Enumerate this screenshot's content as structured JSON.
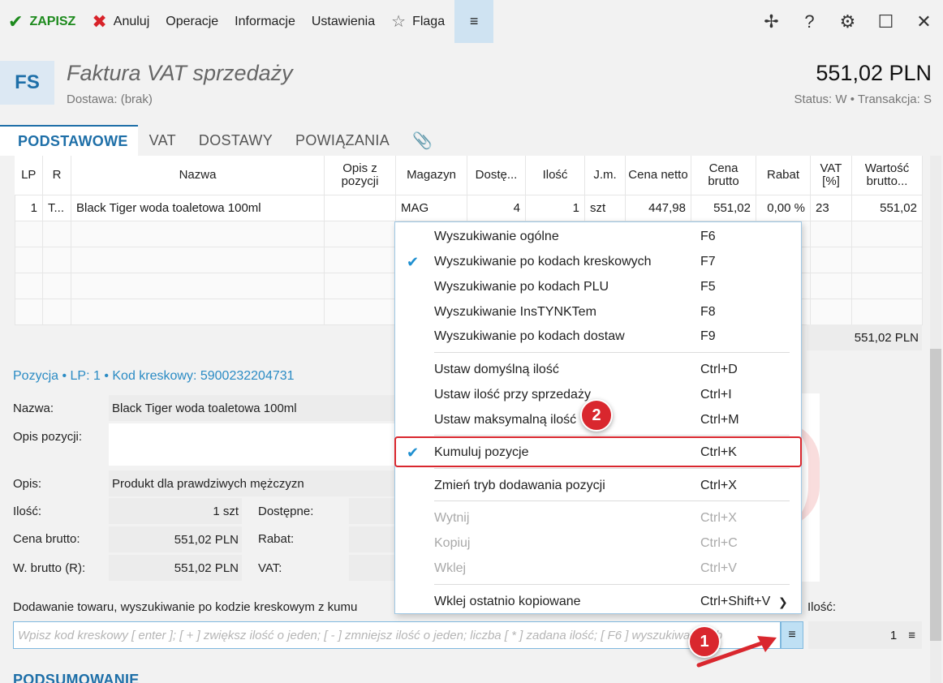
{
  "toolbar": {
    "save": "ZAPISZ",
    "cancel": "Anuluj",
    "operations": "Operacje",
    "information": "Informacje",
    "settings": "Ustawienia",
    "flag": "Flaga"
  },
  "header": {
    "badge": "FS",
    "title": "Faktura VAT sprzedaży",
    "subtitle": "Dostawa: (brak)",
    "amount": "551,02 PLN",
    "status": "Status:  W  •  Transakcja:  S"
  },
  "tabs": [
    "PODSTAWOWE",
    "VAT",
    "DOSTAWY",
    "POWIĄZANIA"
  ],
  "grid": {
    "columns": [
      "LP",
      "R",
      "Nazwa",
      "Opis z pozycji",
      "Magazyn",
      "Dostę...",
      "Ilość",
      "J.m.",
      "Cena netto",
      "Cena brutto",
      "Rabat",
      "VAT [%]",
      "Wartość brutto..."
    ],
    "row": {
      "lp": "1",
      "r": "T...",
      "name": "Black Tiger woda toaletowa 100ml",
      "desc": "",
      "warehouse": "MAG",
      "available": "4",
      "qty": "1",
      "unit": "szt",
      "net": "447,98",
      "gross": "551,02",
      "discount": "0,00 %",
      "vat": "23",
      "value": "551,02"
    },
    "total": "551,02 PLN"
  },
  "position": {
    "heading": "Pozycja •  LP: 1 •  Kod kreskowy: 5900232204731",
    "name_label": "Nazwa:",
    "name_value": "Black Tiger woda toaletowa 100ml",
    "desc_label": "Opis pozycji:",
    "opis_label": "Opis:",
    "opis_value": "Produkt dla prawdziwych mężczyzn",
    "qty_label": "Ilość:",
    "qty_value": "1 szt",
    "available_label": "Dostępne:",
    "gross_label": "Cena brutto:",
    "gross_value": "551,02 PLN",
    "discount_label": "Rabat:",
    "wgross_label": "W. brutto (R):",
    "wgross_value": "551,02 PLN",
    "vat_label": "VAT:"
  },
  "add": {
    "label": "Dodawanie towaru, wyszukiwanie po kodzie kreskowym z kumu",
    "qty_label": "Ilość:",
    "placeholder": "Wpisz kod kreskowy [ enter ]; [ + ] zwiększ ilość o jeden; [ - ] zmniejsz ilość o jeden; liczba [ * ] zadana ilość; [ F6 ] wyszukiwanie zb",
    "qty_value": "1"
  },
  "summary": "PODSUMOWANIE",
  "menu": {
    "items": [
      {
        "label": "Wyszukiwanie ogólne",
        "key": "F6"
      },
      {
        "label": "Wyszukiwanie po kodach kreskowych",
        "key": "F7"
      },
      {
        "label": "Wyszukiwanie po kodach PLU",
        "key": "F5"
      },
      {
        "label": "Wyszukiwanie InsTYNKTem",
        "key": "F8"
      },
      {
        "label": "Wyszukiwanie po kodach dostaw",
        "key": "F9"
      },
      {
        "label": "Ustaw domyślną ilość",
        "key": "Ctrl+D"
      },
      {
        "label": "Ustaw ilość przy sprzedaży",
        "key": "Ctrl+I"
      },
      {
        "label": "Ustaw maksymalną ilość",
        "key": "Ctrl+M"
      },
      {
        "label": "Kumuluj pozycje",
        "key": "Ctrl+K"
      },
      {
        "label": "Zmień tryb dodawania pozycji",
        "key": "Ctrl+X"
      },
      {
        "label": "Wytnij",
        "key": "Ctrl+X"
      },
      {
        "label": "Kopiuj",
        "key": "Ctrl+C"
      },
      {
        "label": "Wklej",
        "key": "Ctrl+V"
      },
      {
        "label": "Wklej ostatnio kopiowane",
        "key": "Ctrl+Shift+V"
      }
    ]
  },
  "callouts": {
    "one": "1",
    "two": "2"
  }
}
